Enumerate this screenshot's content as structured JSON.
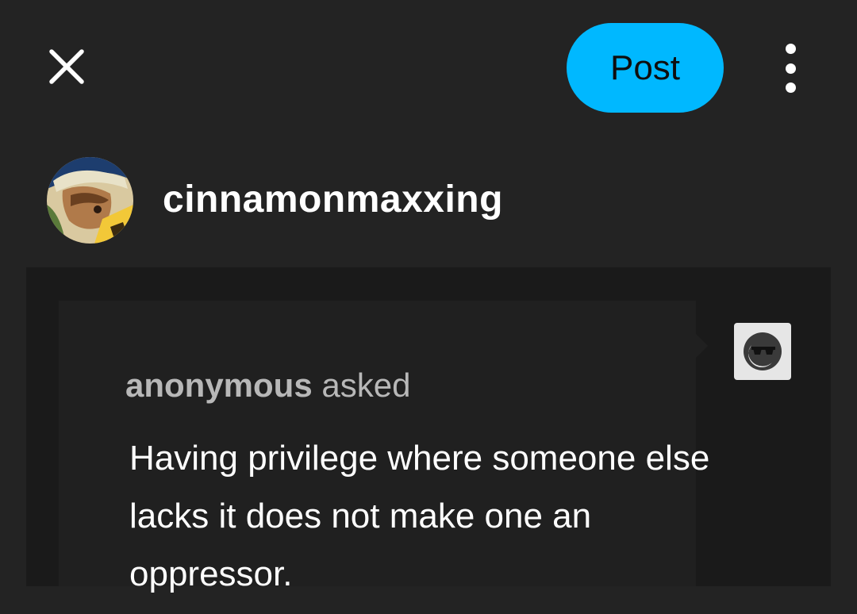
{
  "header": {
    "close_icon": "close-icon",
    "post_label": "Post",
    "more_icon": "more-vertical-icon"
  },
  "post": {
    "username": "cinnamonmaxxing",
    "avatar_icon": "user-avatar"
  },
  "ask": {
    "asker": "anonymous",
    "asked_word": "asked",
    "question": "Having privilege where someone else lacks it does not make one an oppressor.",
    "asker_avatar_icon": "anonymous-avatar-icon"
  },
  "colors": {
    "background": "#232323",
    "panel": "#1a1a1a",
    "bubble": "#202020",
    "accent": "#00b8ff",
    "text": "#ffffff",
    "muted_text": "#b8b8b8"
  }
}
